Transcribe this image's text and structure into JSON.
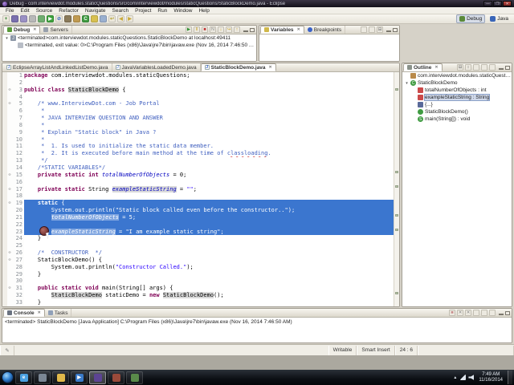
{
  "window": {
    "title": "Debug - com.interviewdot.modules.staticQuestions/src/com/interviewdot/modules/staticQuestions/StaticBlockDemo.java - Eclipse",
    "controls": {
      "minimize": "—",
      "maximize": "❐",
      "close": "✕"
    }
  },
  "menubar": {
    "items": [
      "File",
      "Edit",
      "Source",
      "Refactor",
      "Navigate",
      "Search",
      "Project",
      "Run",
      "Window",
      "Help"
    ]
  },
  "toolbar": {
    "icons": [
      {
        "name": "new-wizard-icon",
        "glyph": "+",
        "bg": "#ece8dc",
        "fg": "#2d7d2d"
      },
      {
        "name": "save-icon",
        "glyph": "",
        "bg": "#7a6fae",
        "fg": "#fff"
      },
      {
        "name": "save-all-icon",
        "glyph": "",
        "bg": "#9a90c4",
        "fg": "#fff"
      },
      {
        "name": "print-icon",
        "glyph": "",
        "bg": "#b8b8b8",
        "fg": "#444"
      },
      {
        "name": "debug-icon",
        "glyph": "",
        "bg": "#6fae6f",
        "fg": "#1d4d1d"
      },
      {
        "name": "run-icon",
        "glyph": "▶",
        "bg": "#3da23d",
        "fg": "#fff"
      },
      {
        "name": "skip-breakpoints-icon",
        "glyph": "⊘",
        "bg": "#ece8dc",
        "fg": "#3a6abf"
      },
      {
        "name": "new-java-project-icon",
        "glyph": "",
        "bg": "#8a7a5a",
        "fg": "#fff"
      },
      {
        "name": "new-package-icon",
        "glyph": "",
        "bg": "#c09a50",
        "fg": "#fff"
      },
      {
        "name": "new-class-icon",
        "glyph": "C",
        "bg": "#3f9b41",
        "fg": "#fff"
      },
      {
        "name": "search-icon",
        "glyph": "",
        "bg": "#d8c050",
        "fg": "#555"
      },
      {
        "name": "open-task-icon",
        "glyph": "",
        "bg": "#9ab0d0",
        "fg": "#fff"
      },
      {
        "name": "last-edit-location-icon",
        "glyph": "↩",
        "bg": "#ece8dc",
        "fg": "#b0a030"
      },
      {
        "name": "back-icon",
        "glyph": "◀",
        "bg": "#ece8dc",
        "fg": "#c8a93a"
      },
      {
        "name": "forward-icon",
        "glyph": "▶",
        "bg": "#ece8dc",
        "fg": "#c8a93a"
      }
    ],
    "perspectives": [
      {
        "label": "Debug",
        "active": true
      },
      {
        "label": "Java",
        "active": false
      }
    ]
  },
  "debug_view": {
    "tabs": [
      {
        "label": "Debug",
        "icon": "bug-icon",
        "glyph": "",
        "active": true
      },
      {
        "label": "Servers",
        "icon": "servers-icon",
        "glyph": "",
        "active": false
      }
    ],
    "toolbar_icons": [
      {
        "name": "resume-icon",
        "glyph": "▶",
        "fg": "#2f8f2f"
      },
      {
        "name": "suspend-icon",
        "glyph": "II",
        "fg": "#c8a020"
      },
      {
        "name": "terminate-icon",
        "glyph": "■",
        "fg": "#c03030"
      },
      {
        "name": "disconnect-icon",
        "glyph": "N",
        "fg": "#888888"
      },
      {
        "name": "step-into-icon",
        "glyph": "↓",
        "fg": "#c8a020"
      },
      {
        "name": "step-over-icon",
        "glyph": "↪",
        "fg": "#c8a020"
      },
      {
        "name": "step-return-icon",
        "glyph": "↑",
        "fg": "#c8a020"
      }
    ],
    "rows": [
      {
        "icon": "java-app-icon",
        "glyph": "J",
        "indent": 0,
        "caret": "▾",
        "text": "<terminated>com.interviewdot.modules.staticQuestions.StaticBlockDemo at localhost:49411"
      },
      {
        "icon": "process-icon",
        "glyph": "",
        "indent": 1,
        "caret": "",
        "text": "<terminated, exit value: 0>C:\\Program Files (x86)\\Java\\jre7\\bin\\javaw.exe (Nov 16, 2014 7:46:50 AM)"
      }
    ]
  },
  "variables_view": {
    "tabs": [
      {
        "label": "Variables",
        "icon": "variables-icon",
        "glyph": "",
        "active": true
      },
      {
        "label": "Breakpoints",
        "icon": "breakpoints-icon",
        "glyph": "",
        "active": false
      }
    ],
    "toolbar_icons": [
      {
        "name": "show-type-names-icon",
        "glyph": "",
        "fg": "#666666"
      },
      {
        "name": "show-logical-structure-icon",
        "glyph": "",
        "fg": "#666666"
      },
      {
        "name": "collapse-all-icon",
        "glyph": "⊟",
        "fg": "#666666"
      }
    ]
  },
  "editor": {
    "tabs": [
      {
        "label": "EclipseArrayListAndLinkedListDemo.java",
        "icon": "java-file-icon",
        "glyph": "J",
        "active": false
      },
      {
        "label": "JavaVariablesLoadedDemo.java",
        "icon": "java-file-icon",
        "glyph": "J",
        "active": false
      },
      {
        "label": "StaticBlockDemo.java",
        "icon": "java-file-icon",
        "glyph": "J",
        "active": true
      }
    ],
    "lines": [
      {
        "n": "1",
        "seg": [
          {
            "t": "package ",
            "c": "kw"
          },
          {
            "t": "com.interviewdot.modules.staticQuestions;",
            "c": "pl"
          }
        ]
      },
      {
        "n": "2",
        "seg": []
      },
      {
        "n": "3",
        "f": 1,
        "seg": [
          {
            "t": "public class ",
            "c": "kw"
          },
          {
            "t": "StaticBlockDemo",
            "c": "pl occ"
          },
          {
            "t": " {",
            "c": "pl"
          }
        ]
      },
      {
        "n": "4",
        "seg": []
      },
      {
        "n": "5",
        "f": 1,
        "seg": [
          {
            "t": "    /* www.InterviewDot.com - Job Portal",
            "c": "cm"
          }
        ]
      },
      {
        "n": "6",
        "seg": [
          {
            "t": "     *",
            "c": "cm"
          }
        ]
      },
      {
        "n": "7",
        "seg": [
          {
            "t": "     * JAVA INTERVIEW QUESTION AND ANSWER",
            "c": "cm"
          }
        ]
      },
      {
        "n": "8",
        "seg": [
          {
            "t": "     *",
            "c": "cm"
          }
        ]
      },
      {
        "n": "9",
        "seg": [
          {
            "t": "     * Explain \"Static block\" in Java ?",
            "c": "cm"
          }
        ]
      },
      {
        "n": "10",
        "seg": [
          {
            "t": "     *",
            "c": "cm"
          }
        ]
      },
      {
        "n": "11",
        "seg": [
          {
            "t": "     *  1. Is used to initialize the static data member.",
            "c": "cm"
          }
        ]
      },
      {
        "n": "12",
        "seg": [
          {
            "t": "     *  2. It is executed before main method at the time of ",
            "c": "cm"
          },
          {
            "t": "classloading",
            "c": "cm ms"
          },
          {
            "t": ".",
            "c": "cm"
          }
        ]
      },
      {
        "n": "13",
        "seg": [
          {
            "t": "     */",
            "c": "cm"
          }
        ]
      },
      {
        "n": "14",
        "seg": [
          {
            "t": "    /*STATIC VARIABLES*/",
            "c": "cm"
          }
        ]
      },
      {
        "n": "15",
        "f": 1,
        "seg": [
          {
            "t": "    ",
            "c": "pl"
          },
          {
            "t": "private static int ",
            "c": "kw"
          },
          {
            "t": "totalNumberOfObjects",
            "c": "fld"
          },
          {
            "t": " = 0;",
            "c": "pl"
          }
        ]
      },
      {
        "n": "16",
        "seg": []
      },
      {
        "n": "17",
        "f": 1,
        "seg": [
          {
            "t": "    ",
            "c": "pl"
          },
          {
            "t": "private static ",
            "c": "kw"
          },
          {
            "t": "String ",
            "c": "pl"
          },
          {
            "t": "exampleStaticString",
            "c": "fld occ"
          },
          {
            "t": " = ",
            "c": "pl"
          },
          {
            "t": "\"\"",
            "c": "str"
          },
          {
            "t": ";",
            "c": "pl"
          }
        ]
      },
      {
        "n": "18",
        "seg": []
      },
      {
        "n": "19",
        "f": 1,
        "sel": true,
        "seg": [
          {
            "t": "    ",
            "c": "pl"
          },
          {
            "t": "static",
            "c": "kw"
          },
          {
            "t": " {",
            "c": "pl"
          }
        ]
      },
      {
        "n": "20",
        "sel": true,
        "seg": [
          {
            "t": "        System.out.println(",
            "c": "pl"
          },
          {
            "t": "\"Static block called even before the constructor..\"",
            "c": "str"
          },
          {
            "t": ");",
            "c": "pl"
          }
        ]
      },
      {
        "n": "21",
        "sel": true,
        "seg": [
          {
            "t": "        ",
            "c": "pl"
          },
          {
            "t": "totalNumberOfObjects",
            "c": "fld occ"
          },
          {
            "t": " = 5;",
            "c": "pl"
          }
        ]
      },
      {
        "n": "22",
        "sel": true,
        "seg": []
      },
      {
        "n": "23",
        "sel": true,
        "seg": [
          {
            "t": "        ",
            "c": "pl"
          },
          {
            "t": "exampleStaticString",
            "c": "fld occ"
          },
          {
            "t": " = ",
            "c": "pl"
          },
          {
            "t": "\"I am example static string\"",
            "c": "str"
          },
          {
            "t": ";",
            "c": "pl"
          }
        ]
      },
      {
        "n": "24",
        "seg": [
          {
            "t": "    }",
            "c": "pl"
          }
        ]
      },
      {
        "n": "25",
        "seg": []
      },
      {
        "n": "26",
        "f": 1,
        "seg": [
          {
            "t": "    /*  CONSTRUCTOR  */",
            "c": "cm"
          }
        ]
      },
      {
        "n": "27",
        "f": 1,
        "seg": [
          {
            "t": "    StaticBlockDemo() {",
            "c": "pl"
          }
        ]
      },
      {
        "n": "28",
        "seg": [
          {
            "t": "        System.out.println(",
            "c": "pl"
          },
          {
            "t": "\"Constructor Called.\"",
            "c": "str"
          },
          {
            "t": ");",
            "c": "pl"
          }
        ]
      },
      {
        "n": "29",
        "seg": [
          {
            "t": "    }",
            "c": "pl"
          }
        ]
      },
      {
        "n": "30",
        "seg": []
      },
      {
        "n": "31",
        "f": 1,
        "seg": [
          {
            "t": "    ",
            "c": "pl"
          },
          {
            "t": "public static void ",
            "c": "kw"
          },
          {
            "t": "main(String[] args) {",
            "c": "pl"
          }
        ]
      },
      {
        "n": "32",
        "seg": [
          {
            "t": "        ",
            "c": "pl"
          },
          {
            "t": "StaticBlockDemo",
            "c": "pl occ"
          },
          {
            "t": " staticDemo = ",
            "c": "pl"
          },
          {
            "t": "new",
            "c": "kw"
          },
          {
            "t": " ",
            "c": "pl"
          },
          {
            "t": "StaticBlockDemo",
            "c": "pl occ"
          },
          {
            "t": "();",
            "c": "pl"
          }
        ]
      },
      {
        "n": "33",
        "seg": [
          {
            "t": "    }",
            "c": "pl"
          }
        ]
      }
    ]
  },
  "outline": {
    "tabs": [
      {
        "label": "Outline",
        "icon": "outline-icon",
        "glyph": "",
        "active": true
      }
    ],
    "toolbar_icons": [
      {
        "name": "collapse-all-icon",
        "glyph": "⊟",
        "fg": "#666666"
      },
      {
        "name": "sort-icon",
        "glyph": "↕",
        "fg": "#666666"
      },
      {
        "name": "hide-fields-icon",
        "glyph": "",
        "fg": "#666666"
      },
      {
        "name": "hide-static-members-icon",
        "glyph": "",
        "fg": "#666666"
      },
      {
        "name": "hide-non-public-icon",
        "glyph": "",
        "fg": "#666666"
      }
    ],
    "items": [
      {
        "label": "com.interviewdot.modules.staticQuestions",
        "icon": "package-icon",
        "glyph": "",
        "indent": 0,
        "caret": ""
      },
      {
        "label": "StaticBlockDemo",
        "icon": "class-icon",
        "glyph": "C",
        "indent": 0,
        "caret": "▾"
      },
      {
        "label": "totalNumberOfObjects : int",
        "icon": "field-private-icon",
        "glyph": "",
        "indent": 1,
        "caret": ""
      },
      {
        "label": "exampleStaticString : String",
        "icon": "field-private-icon",
        "glyph": "",
        "indent": 1,
        "caret": "",
        "selected": true
      },
      {
        "label": "{...}",
        "icon": "static-initializer-icon",
        "glyph": "",
        "indent": 1,
        "caret": ""
      },
      {
        "label": "StaticBlockDemo()",
        "icon": "constructor-icon",
        "glyph": "",
        "indent": 1,
        "caret": ""
      },
      {
        "label": "main(String[]) : void",
        "icon": "method-static-icon",
        "glyph": "S",
        "indent": 1,
        "caret": ""
      }
    ]
  },
  "console": {
    "tabs": [
      {
        "label": "Console",
        "icon": "console-icon",
        "glyph": "",
        "active": true
      },
      {
        "label": "Tasks",
        "icon": "tasks-icon",
        "glyph": "",
        "active": false
      }
    ],
    "toolbar_icons": [
      {
        "name": "terminate-icon",
        "glyph": "■",
        "fg": "#c88a8a"
      },
      {
        "name": "remove-launch-icon",
        "glyph": "✕",
        "fg": "#888888"
      },
      {
        "name": "remove-all-launches-icon",
        "glyph": "✕",
        "fg": "#888888"
      },
      {
        "name": "clear-console-icon",
        "glyph": "",
        "fg": "#888888"
      },
      {
        "name": "scroll-lock-icon",
        "glyph": "",
        "fg": "#888888"
      },
      {
        "name": "pin-console-icon",
        "glyph": "",
        "fg": "#888888"
      }
    ],
    "text": "<terminated> StaticBlockDemo [Java Application] C:\\Program Files (x86)\\Java\\jre7\\bin\\javaw.exe (Nov 16, 2014 7:46:50 AM)"
  },
  "status_bar": {
    "writable": "Writable",
    "input_mode": "Smart Insert",
    "caret_position": "24 : 6"
  },
  "taskbar": {
    "apps": [
      {
        "name": "internet-explorer-icon",
        "color": "#4aa0e0",
        "glyph": "e",
        "active": false
      },
      {
        "name": "taskbar-app-icon-2",
        "color": "#7a8694",
        "glyph": "",
        "active": false
      },
      {
        "name": "windows-explorer-icon",
        "color": "#e0b84a",
        "glyph": "",
        "active": false
      },
      {
        "name": "media-player-icon",
        "color": "#3a7ac8",
        "glyph": "▶",
        "active": false
      },
      {
        "name": "eclipse-icon",
        "color": "#5c4494",
        "glyph": "",
        "active": true
      },
      {
        "name": "taskbar-app-icon-6",
        "color": "#9a4a3a",
        "glyph": "",
        "active": false
      },
      {
        "name": "taskbar-app-icon-7",
        "color": "#5a8a4a",
        "glyph": "",
        "active": false
      }
    ],
    "tray_time": "7:49 AM",
    "tray_date": "11/16/2014"
  }
}
